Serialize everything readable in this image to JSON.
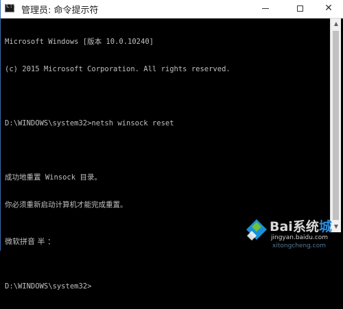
{
  "window": {
    "title": "管理员: 命令提示符",
    "icon": "cmd-icon",
    "controls": {
      "minimize": "minimize-icon",
      "maximize": "maximize-icon",
      "close": "✕"
    }
  },
  "console": {
    "lines": [
      "Microsoft Windows [版本 10.0.10240]",
      "(c) 2015 Microsoft Corporation. All rights reserved.",
      "",
      "D:\\WINDOWS\\system32>netsh winsock reset",
      "",
      "成功地重置 Winsock 目录。",
      "你必须重新启动计算机才能完成重置。",
      "",
      "",
      "D:\\WINDOWS\\system32>"
    ]
  },
  "ime": {
    "status": "微软拼音 半 ："
  },
  "watermark": {
    "brand_a": "Bai",
    "brand_b": "系统",
    "brand_c": "城",
    "site": "jingyan.baidu.com",
    "site2": "xitongcheng.com"
  },
  "colors": {
    "background": "#000000",
    "text": "#c0c0c0",
    "titlebar": "#ffffff"
  }
}
